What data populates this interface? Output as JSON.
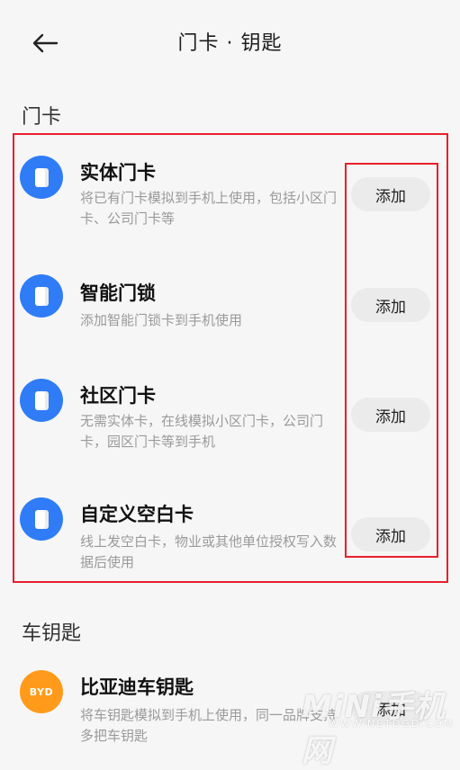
{
  "header": {
    "title": "门卡 · 钥匙",
    "back_icon": "arrow-left-icon"
  },
  "sections": {
    "access_cards": {
      "title": "门卡",
      "items": [
        {
          "title": "实体门卡",
          "desc": "将已有门卡模拟到手机上使用，包括小区门卡、公司门卡等",
          "button": "添加",
          "icon": "card-icon"
        },
        {
          "title": "智能门锁",
          "desc": "添加智能门锁卡到手机使用",
          "button": "添加",
          "icon": "card-icon"
        },
        {
          "title": "社区门卡",
          "desc": "无需实体卡，在线模拟小区门卡，公司门卡，园区门卡等到手机",
          "button": "添加",
          "icon": "card-icon"
        },
        {
          "title": "自定义空白卡",
          "desc": "线上发空白卡，物业或其他单位授权写入数据后使用",
          "button": "添加",
          "icon": "card-icon"
        }
      ]
    },
    "car_keys": {
      "title": "车钥匙",
      "items": [
        {
          "title": "比亚迪车钥匙",
          "desc": "将车钥匙模拟到手机上使用，同一品牌支持多把车钥匙",
          "button": "添加",
          "icon": "byd-logo-icon",
          "logo_text": "BYD"
        }
      ]
    }
  },
  "watermark": {
    "main": "MiNi手机网",
    "sub": "WWW.NETDGD.COM"
  },
  "colors": {
    "card_icon_blue": "#2f7cf6",
    "byd_orange": "#ff9a1a",
    "highlight_red": "#e8202a",
    "button_bg": "#ebebeb",
    "page_bg": "#f6f6f6"
  }
}
